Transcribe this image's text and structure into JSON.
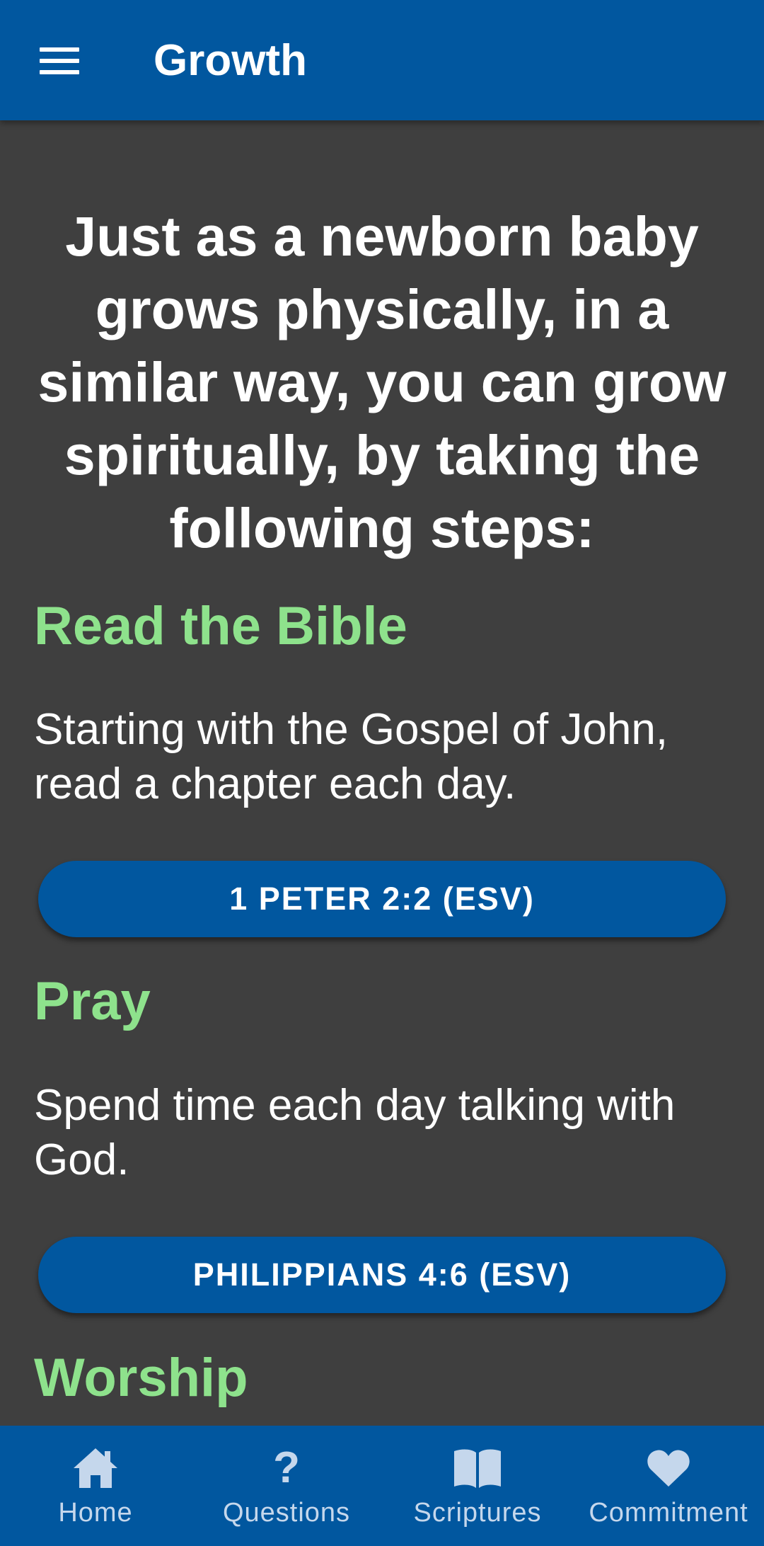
{
  "app_bar": {
    "title": "Growth",
    "menu_icon": "hamburger-menu-icon"
  },
  "intro_text": "Just as a newborn baby grows physically, in a similar way, you can grow spiritually, by taking the following steps:",
  "steps": [
    {
      "heading": "Read the Bible",
      "text": "Starting with the Gospel of John, read a chapter each day.",
      "button_label": "1 PETER 2:2 (ESV)"
    },
    {
      "heading": "Pray",
      "text": "Spend time each day talking with God.",
      "button_label": "PHILIPPIANS 4:6 (ESV)"
    },
    {
      "heading": "Worship"
    }
  ],
  "bottom_nav": {
    "items": [
      {
        "label": "Home",
        "icon": "home-icon"
      },
      {
        "label": "Questions",
        "icon": "question-icon"
      },
      {
        "label": "Scriptures",
        "icon": "book-icon"
      },
      {
        "label": "Commitment",
        "icon": "heart-icon"
      }
    ]
  },
  "colors": {
    "primary": "#01579f",
    "background": "#3f3f3f",
    "heading_green": "#8ee28c",
    "nav_inactive": "#c5d7ec"
  }
}
